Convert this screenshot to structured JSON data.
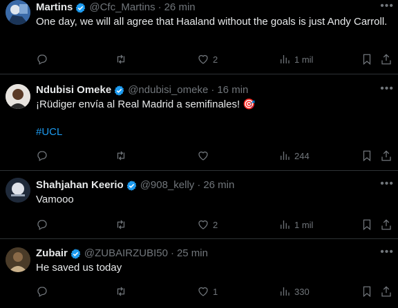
{
  "tweets": [
    {
      "name": "Martins",
      "handle": "@Cfc_Martins",
      "time": "26 min",
      "text": "One day, we will all agree that Haaland without the goals is just Andy Carroll.",
      "replies": "",
      "retweets": "",
      "likes": "2",
      "views": "1 mil"
    },
    {
      "name": "Ndubisi Omeke",
      "handle": "@ndubisi_omeke",
      "time": "16 min",
      "text": "¡Rüdiger envía al Real Madrid a semifinales! 🎯",
      "hashtag": "#UCL",
      "replies": "",
      "retweets": "",
      "likes": "",
      "views": "244"
    },
    {
      "name": "Shahjahan Keerio",
      "handle": "@908_kelly",
      "time": "26 min",
      "text": "Vamooo",
      "replies": "",
      "retweets": "",
      "likes": "2",
      "views": "1 mil"
    },
    {
      "name": "Zubair",
      "handle": "@ZUBAIRZUBI50",
      "time": "25 min",
      "text": "He saved us today",
      "replies": "",
      "retweets": "",
      "likes": "1",
      "views": "330"
    }
  ],
  "separator": "·",
  "colors": {
    "background": "#000000",
    "text": "#e7e9ea",
    "muted": "#71767b",
    "accent": "#1d9bf0",
    "border": "#2f3336"
  },
  "icons": {
    "verified": "verified-badge-icon",
    "more": "more-icon",
    "reply": "reply-icon",
    "retweet": "retweet-icon",
    "like": "heart-icon",
    "views": "views-icon",
    "bookmark": "bookmark-icon",
    "share": "share-icon"
  }
}
